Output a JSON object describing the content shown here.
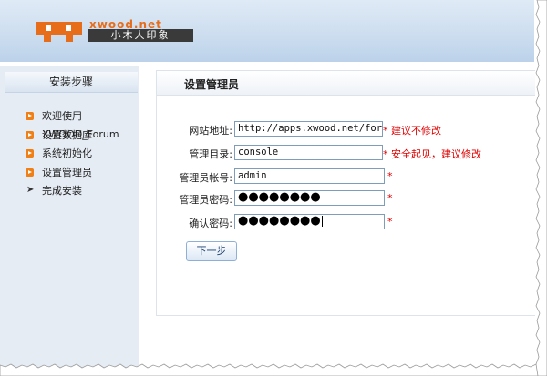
{
  "header": {
    "logo_brand_en": "xwood.net",
    "logo_brand_cn": "小木人印象"
  },
  "sidebar": {
    "title": "安装步骤",
    "steps": [
      {
        "label": "欢迎使用XWOOD_Forum",
        "icon": "orange-arrow-icon"
      },
      {
        "label": "设置数据库",
        "icon": "orange-arrow-icon"
      },
      {
        "label": "系统初始化",
        "icon": "orange-arrow-icon"
      },
      {
        "label": "设置管理员",
        "icon": "orange-arrow-icon"
      },
      {
        "label": "完成安装",
        "icon": "black-chevron-icon"
      }
    ]
  },
  "content": {
    "title": "设置管理员",
    "form": {
      "site_url": {
        "label": "网站地址:",
        "value": "http://apps.xwood.net/forum",
        "hint": "* 建议不修改"
      },
      "admin_dir": {
        "label": "管理目录:",
        "value": "console",
        "hint": "* 安全起见，建议修改"
      },
      "admin_account": {
        "label": "管理员帐号:",
        "value": "admin",
        "hint": "*"
      },
      "admin_password": {
        "label": "管理员密码:",
        "value": "●●●●●●●●",
        "hint": "*"
      },
      "confirm_password": {
        "label": "确认密码:",
        "value": "●●●●●●●●",
        "hint": "*"
      }
    },
    "next_button": "下一步"
  },
  "colors": {
    "accent_orange": "#f07f16",
    "hint_red": "#e00000",
    "sidebar_bg": "#e6ecf4",
    "header_blue": "#cfdff0"
  }
}
